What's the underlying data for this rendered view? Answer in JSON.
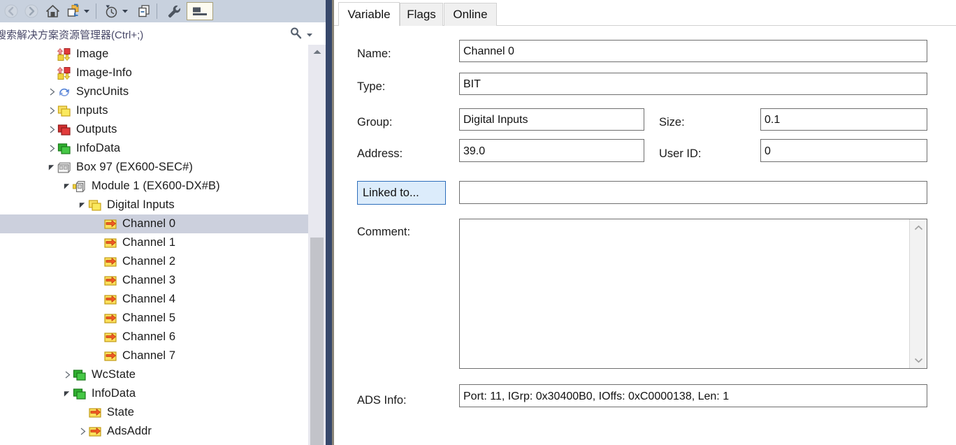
{
  "toolbar": {
    "buttons": [
      {
        "name": "back-icon",
        "label": "Back",
        "enabled": false
      },
      {
        "name": "forward-icon",
        "label": "Forward",
        "enabled": false
      },
      {
        "name": "home-icon",
        "label": "Home",
        "enabled": true
      },
      {
        "name": "sync-with-active-document-icon",
        "label": "Sync with Active Document",
        "enabled": true
      },
      {
        "name": "dropdown-arrow-icon",
        "label": "More",
        "enabled": true
      },
      {
        "name": "pending-changes-icon",
        "label": "Pending Changes",
        "enabled": true
      },
      {
        "name": "dropdown-arrow-icon",
        "label": "More",
        "enabled": true
      },
      {
        "name": "show-all-files-icon",
        "label": "Show All Files",
        "enabled": true
      },
      {
        "name": "properties-icon",
        "label": "Properties",
        "enabled": true
      },
      {
        "name": "collapse-icon",
        "label": "Collapse All",
        "enabled": true
      }
    ]
  },
  "search": {
    "value": "搜索解决方案资源管理器(Ctrl+;)",
    "placeholder": "搜索解决方案资源管理器(Ctrl+;)",
    "magnifier_icon": "search-icon",
    "dropdown_icon": "chevron-down-icon"
  },
  "tree": {
    "nodes": [
      {
        "label": "Image",
        "indent": 3,
        "expander": "none",
        "icon": "image-io-icon",
        "selected": false
      },
      {
        "label": "Image-Info",
        "indent": 3,
        "expander": "none",
        "icon": "image-io-icon",
        "selected": false
      },
      {
        "label": "SyncUnits",
        "indent": 3,
        "expander": "collapsed",
        "icon": "sync-units-icon",
        "selected": false
      },
      {
        "label": "Inputs",
        "indent": 3,
        "expander": "collapsed",
        "icon": "folder-yellow-icon",
        "selected": false
      },
      {
        "label": "Outputs",
        "indent": 3,
        "expander": "collapsed",
        "icon": "folder-red-icon",
        "selected": false
      },
      {
        "label": "InfoData",
        "indent": 3,
        "expander": "collapsed",
        "icon": "folder-green-icon",
        "selected": false
      },
      {
        "label": "Box 97 (EX600-SEC#)",
        "indent": 3,
        "expander": "expanded",
        "icon": "box-icon",
        "selected": false
      },
      {
        "label": "Module 1 (EX600-DX#B)",
        "indent": 4,
        "expander": "expanded",
        "icon": "module-icon",
        "selected": false
      },
      {
        "label": "Digital Inputs",
        "indent": 5,
        "expander": "expanded",
        "icon": "folder-yellow-icon",
        "selected": false
      },
      {
        "label": "Channel 0",
        "indent": 6,
        "expander": "none",
        "icon": "variable-in-icon",
        "selected": true
      },
      {
        "label": "Channel 1",
        "indent": 6,
        "expander": "none",
        "icon": "variable-in-icon",
        "selected": false
      },
      {
        "label": "Channel 2",
        "indent": 6,
        "expander": "none",
        "icon": "variable-in-icon",
        "selected": false
      },
      {
        "label": "Channel 3",
        "indent": 6,
        "expander": "none",
        "icon": "variable-in-icon",
        "selected": false
      },
      {
        "label": "Channel 4",
        "indent": 6,
        "expander": "none",
        "icon": "variable-in-icon",
        "selected": false
      },
      {
        "label": "Channel 5",
        "indent": 6,
        "expander": "none",
        "icon": "variable-in-icon",
        "selected": false
      },
      {
        "label": "Channel 6",
        "indent": 6,
        "expander": "none",
        "icon": "variable-in-icon",
        "selected": false
      },
      {
        "label": "Channel 7",
        "indent": 6,
        "expander": "none",
        "icon": "variable-in-icon",
        "selected": false
      },
      {
        "label": "WcState",
        "indent": 4,
        "expander": "collapsed",
        "icon": "folder-green-icon",
        "selected": false
      },
      {
        "label": "InfoData",
        "indent": 4,
        "expander": "expanded",
        "icon": "folder-green-icon",
        "selected": false
      },
      {
        "label": "State",
        "indent": 5,
        "expander": "none",
        "icon": "variable-in-icon",
        "selected": false
      },
      {
        "label": "AdsAddr",
        "indent": 5,
        "expander": "collapsed",
        "icon": "variable-in-icon",
        "selected": false
      }
    ],
    "scrollbar": {
      "up_arrow_icon": "scroll-up-icon"
    }
  },
  "tabs": [
    {
      "label": "Variable",
      "active": true
    },
    {
      "label": "Flags",
      "active": false
    },
    {
      "label": "Online",
      "active": false
    }
  ],
  "form": {
    "name": {
      "label": "Name:",
      "value": "Channel 0"
    },
    "type": {
      "label": "Type:",
      "value": "BIT"
    },
    "group": {
      "label": "Group:",
      "value": "Digital Inputs"
    },
    "size": {
      "label": "Size:",
      "value": "0.1"
    },
    "address": {
      "label": "Address:",
      "value": "39.0"
    },
    "userid": {
      "label": "User ID:",
      "value": "0"
    },
    "linked_to": {
      "label": "Linked to...",
      "value": ""
    },
    "comment": {
      "label": "Comment:",
      "value": ""
    },
    "ads_info": {
      "label": "ADS Info:",
      "value": "Port: 11, IGrp: 0x30400B0, IOffs: 0xC0000138, Len: 1"
    }
  },
  "colors": {
    "toolbar_bg": "#c8d1de",
    "splitter": "#37486b",
    "selection": "#ccd0dd",
    "link_button_bg": "#dcecfb",
    "link_button_border": "#2d6ebb"
  }
}
